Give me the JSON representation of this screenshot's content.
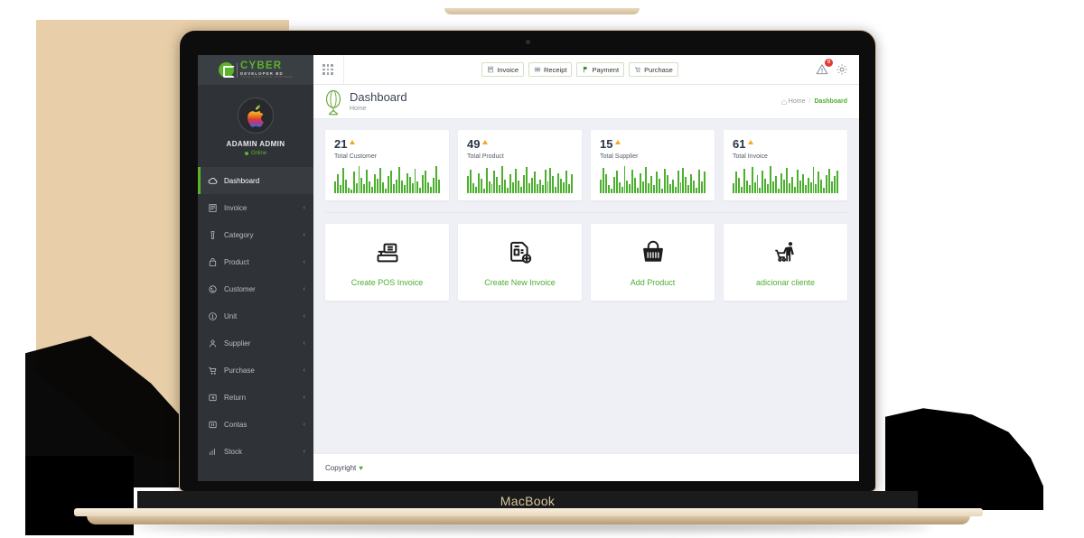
{
  "device": {
    "brand_label": "MacBook"
  },
  "sidebar": {
    "logo": {
      "mark": "cyber-c-logo-icon",
      "main": "CYBER",
      "sub": "DEVELOPER BD",
      "tagline": "YOUR CREATIVE PARTNER"
    },
    "profile": {
      "avatar": "apple-logo-avatar",
      "name": "ADAMIN ADMIN",
      "status": "Online",
      "status_color": "#5bb32b"
    },
    "items": [
      {
        "label": "Dashboard",
        "icon": "dashboard-cloud-icon",
        "active": true,
        "caret": ""
      },
      {
        "label": "Invoice",
        "icon": "invoice-icon",
        "active": false,
        "caret": "‹"
      },
      {
        "label": "Category",
        "icon": "category-icon",
        "active": false,
        "caret": "‹"
      },
      {
        "label": "Product",
        "icon": "product-bag-icon",
        "active": false,
        "caret": "‹"
      },
      {
        "label": "Customer",
        "icon": "customer-icon",
        "active": false,
        "caret": "‹"
      },
      {
        "label": "Unit",
        "icon": "unit-icon",
        "active": false,
        "caret": "‹"
      },
      {
        "label": "Supplier",
        "icon": "supplier-user-icon",
        "active": false,
        "caret": "‹"
      },
      {
        "label": "Purchase",
        "icon": "purchase-cart-icon",
        "active": false,
        "caret": "‹"
      },
      {
        "label": "Return",
        "icon": "return-icon",
        "active": false,
        "caret": "‹"
      },
      {
        "label": "Contas",
        "icon": "contas-icon",
        "active": false,
        "caret": "‹"
      },
      {
        "label": "Stock",
        "icon": "stock-bars-icon",
        "active": false,
        "caret": "‹"
      }
    ]
  },
  "topbar": {
    "menu_icon": "grid-menu-icon",
    "buttons": [
      {
        "label": "Invoice",
        "icon": "invoice-icon"
      },
      {
        "label": "Receipt",
        "icon": "receipt-icon"
      },
      {
        "label": "Payment",
        "icon": "payment-icon"
      },
      {
        "label": "Purchase",
        "icon": "purchase-cart-icon"
      }
    ],
    "alert": {
      "icon": "warning-triangle-icon",
      "badge": "0",
      "badge_color": "#e03c31"
    },
    "settings": {
      "icon": "gear-icon"
    }
  },
  "page": {
    "icon": "globe-icon",
    "title": "Dashboard",
    "subtitle": "Home",
    "breadcrumb": {
      "home": "Home",
      "separator": "/",
      "current": "Dashboard"
    }
  },
  "stats": [
    {
      "value": "21",
      "label": "Total Customer",
      "trend": "up",
      "spark": [
        12,
        20,
        8,
        26,
        14,
        6,
        4,
        22,
        10,
        28,
        16,
        9,
        24,
        12,
        7,
        20,
        15,
        26,
        11,
        5,
        18,
        23,
        9,
        14,
        27,
        13,
        8,
        21,
        17,
        10,
        25,
        12,
        6,
        19,
        23,
        11,
        7,
        16,
        28,
        14
      ]
    },
    {
      "value": "49",
      "label": "Total Product",
      "trend": "up",
      "spark": [
        18,
        24,
        10,
        7,
        21,
        15,
        5,
        26,
        12,
        9,
        23,
        17,
        8,
        28,
        14,
        6,
        20,
        11,
        25,
        13,
        7,
        19,
        27,
        10,
        16,
        22,
        9,
        14,
        8,
        24,
        12,
        26,
        18,
        7,
        21,
        15,
        11,
        23,
        9,
        20
      ]
    },
    {
      "value": "15",
      "label": "Total Supplier",
      "trend": "up",
      "spark": [
        14,
        26,
        20,
        8,
        5,
        17,
        23,
        11,
        7,
        28,
        13,
        9,
        24,
        16,
        6,
        21,
        12,
        27,
        10,
        18,
        8,
        22,
        15,
        5,
        25,
        19,
        9,
        14,
        7,
        23,
        11,
        26,
        17,
        8,
        20,
        13,
        6,
        24,
        12,
        22
      ]
    },
    {
      "value": "61",
      "label": "Total Invoice",
      "trend": "up",
      "spark": [
        10,
        22,
        16,
        7,
        25,
        13,
        8,
        27,
        11,
        19,
        6,
        23,
        15,
        9,
        28,
        12,
        18,
        5,
        21,
        14,
        26,
        10,
        17,
        7,
        24,
        13,
        20,
        8,
        16,
        11,
        27,
        9,
        22,
        14,
        6,
        19,
        25,
        12,
        18,
        23
      ]
    }
  ],
  "actions": [
    {
      "label": "Create POS Invoice",
      "icon": "cash-register-icon"
    },
    {
      "label": "Create New Invoice",
      "icon": "document-add-icon"
    },
    {
      "label": "Add Product",
      "icon": "shopping-basket-icon"
    },
    {
      "label": "adicionar cliente",
      "icon": "shopper-with-cart-icon"
    }
  ],
  "footer": {
    "text": "Copyright",
    "heart": "♥"
  },
  "colors": {
    "brand_green": "#4caf2f",
    "sidebar": "#2f3337",
    "accent_orange": "#f6a623",
    "content_bg": "#eff0f5"
  }
}
